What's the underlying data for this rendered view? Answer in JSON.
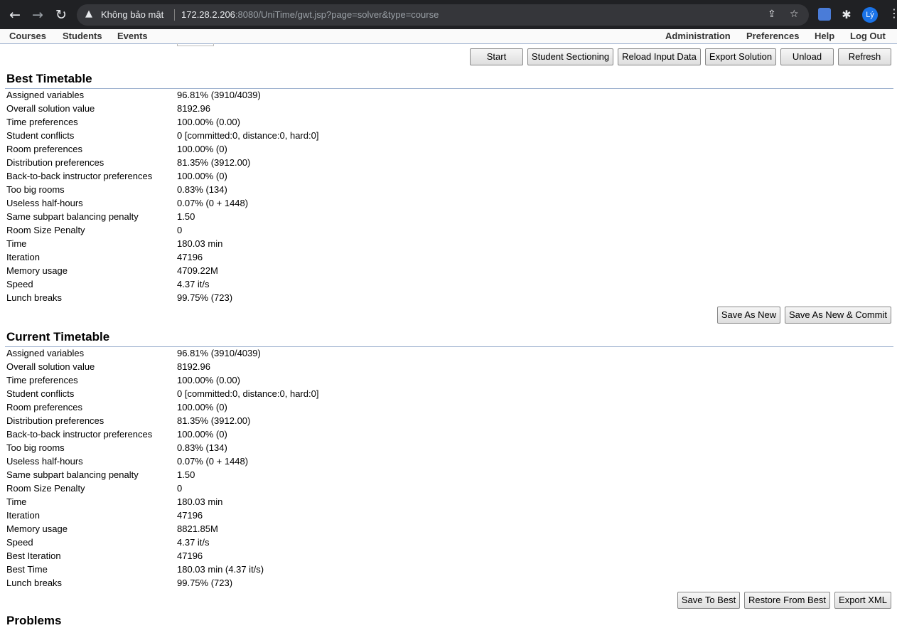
{
  "browser": {
    "security_label": "Không bảo mật",
    "url_host": "172.28.2.206",
    "url_rest": ":8080/UniTime/gwt.jsp?page=solver&type=course",
    "profile_initials": "Lý"
  },
  "menu": {
    "left": [
      "Courses",
      "Students",
      "Events"
    ],
    "right": [
      "Administration",
      "Preferences",
      "Help",
      "Log Out"
    ]
  },
  "toolbar": {
    "start": "Start",
    "student_sectioning": "Student Sectioning",
    "reload_input_data": "Reload Input Data",
    "export_solution": "Export Solution",
    "unload": "Unload",
    "refresh": "Refresh"
  },
  "best": {
    "title": "Best Timetable",
    "rows": [
      {
        "k": "Assigned variables",
        "v": "96.81% (3910/4039)"
      },
      {
        "k": "Overall solution value",
        "v": "8192.96"
      },
      {
        "k": "Time preferences",
        "v": "100.00% (0.00)"
      },
      {
        "k": "Student conflicts",
        "v": "0 [committed:0, distance:0, hard:0]"
      },
      {
        "k": "Room preferences",
        "v": "100.00% (0)"
      },
      {
        "k": "Distribution preferences",
        "v": "81.35% (3912.00)"
      },
      {
        "k": "Back-to-back instructor preferences",
        "v": "100.00% (0)"
      },
      {
        "k": "Too big rooms",
        "v": "0.83% (134)"
      },
      {
        "k": "Useless half-hours",
        "v": "0.07% (0 + 1448)"
      },
      {
        "k": "Same subpart balancing penalty",
        "v": "1.50"
      },
      {
        "k": "Room Size Penalty",
        "v": "0"
      },
      {
        "k": "Time",
        "v": "180.03 min"
      },
      {
        "k": "Iteration",
        "v": "47196"
      },
      {
        "k": "Memory usage",
        "v": "4709.22M"
      },
      {
        "k": "Speed",
        "v": "4.37 it/s"
      },
      {
        "k": "Lunch breaks",
        "v": "99.75% (723)"
      }
    ],
    "save_as_new": "Save As New",
    "save_as_new_commit": "Save As New & Commit"
  },
  "current": {
    "title": "Current Timetable",
    "rows": [
      {
        "k": "Assigned variables",
        "v": "96.81% (3910/4039)"
      },
      {
        "k": "Overall solution value",
        "v": "8192.96"
      },
      {
        "k": "Time preferences",
        "v": "100.00% (0.00)"
      },
      {
        "k": "Student conflicts",
        "v": "0 [committed:0, distance:0, hard:0]"
      },
      {
        "k": "Room preferences",
        "v": "100.00% (0)"
      },
      {
        "k": "Distribution preferences",
        "v": "81.35% (3912.00)"
      },
      {
        "k": "Back-to-back instructor preferences",
        "v": "100.00% (0)"
      },
      {
        "k": "Too big rooms",
        "v": "0.83% (134)"
      },
      {
        "k": "Useless half-hours",
        "v": "0.07% (0 + 1448)"
      },
      {
        "k": "Same subpart balancing penalty",
        "v": "1.50"
      },
      {
        "k": "Room Size Penalty",
        "v": "0"
      },
      {
        "k": "Time",
        "v": "180.03 min"
      },
      {
        "k": "Iteration",
        "v": "47196"
      },
      {
        "k": "Memory usage",
        "v": "8821.85M"
      },
      {
        "k": "Speed",
        "v": "4.37 it/s"
      },
      {
        "k": "Best Iteration",
        "v": "47196"
      },
      {
        "k": "Best Time",
        "v": "180.03 min (4.37 it/s)"
      },
      {
        "k": "Lunch breaks",
        "v": "99.75% (723)"
      }
    ],
    "save_to_best": "Save To Best",
    "restore_from_best": "Restore From Best",
    "export_xml": "Export XML"
  },
  "problems": {
    "title": "Problems"
  }
}
